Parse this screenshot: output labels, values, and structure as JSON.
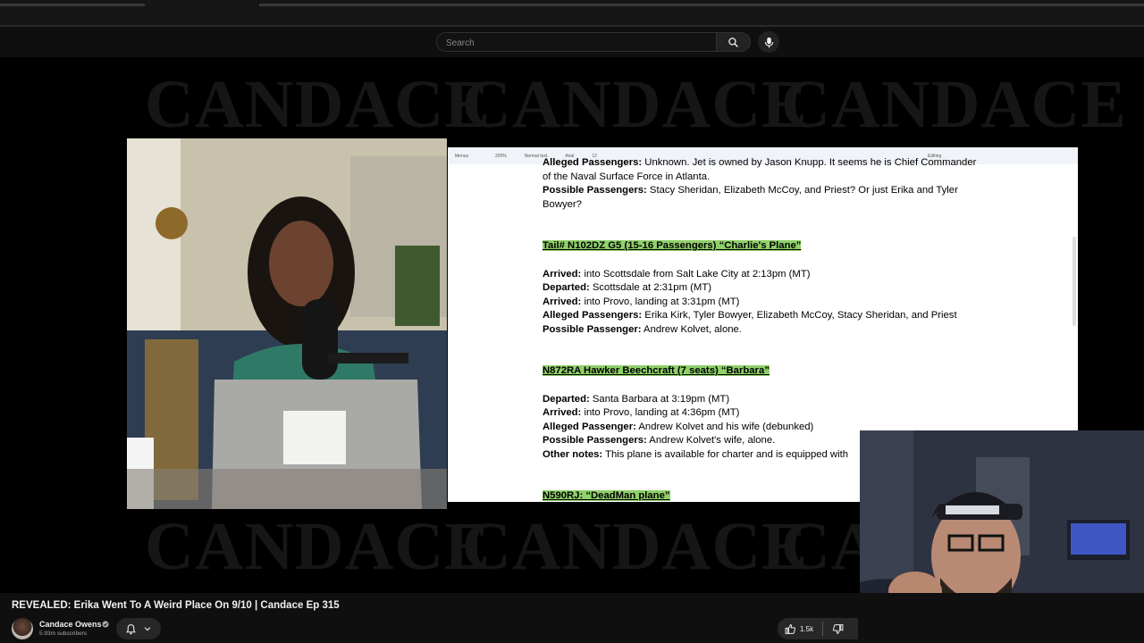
{
  "search": {
    "placeholder": "Search"
  },
  "watermark": {
    "text": "CANDACE"
  },
  "doc": {
    "toolbar": {
      "menus": "Menus",
      "zoom": "200%",
      "style": "Normal text",
      "font": "Arial",
      "size": "12",
      "mode": "Editing"
    },
    "lines": [
      {
        "label": "Alleged Passengers:",
        "text": " Unknown. Jet is owned by Jason Knupp. It seems he is Chief Commander"
      },
      {
        "label": "",
        "text": "of the Naval Surface Force in Atlanta."
      },
      {
        "label": "Possible Passengers:",
        "text": " Stacy Sheridan, Elizabeth McCoy, and Priest? Or just Erika and Tyler"
      },
      {
        "label": "",
        "text": "Bowyer?"
      },
      {
        "heading": "Tail# N102DZ G5 (15-16 Passengers) “Charlie's Plane”"
      },
      {
        "label": "Arrived:",
        "text": " into Scottsdale from Salt Lake City at 2:13pm (MT)"
      },
      {
        "label": "Departed:",
        "text": " Scottsdale at 2:31pm (MT)"
      },
      {
        "label": "Arrived:",
        "text": " into Provo, landing at 3:31pm (MT)"
      },
      {
        "label": "Alleged Passengers:",
        "text": " Erika Kirk, Tyler Bowyer, Elizabeth McCoy, Stacy Sheridan, and Priest"
      },
      {
        "label": "Possible Passenger:",
        "text": " Andrew Kolvet, alone."
      },
      {
        "heading": "N872RA Hawker Beechcraft  (7 seats) “Barbara”"
      },
      {
        "label": "Departed:",
        "text": " Santa Barbara at 3:19pm (MT)"
      },
      {
        "label": "Arrived:",
        "text": " into Provo, landing at 4:36pm (MT)"
      },
      {
        "label": "Alleged Passenger:",
        "text": " Andrew Kolvet and his wife (debunked)"
      },
      {
        "label": "Possible Passengers:",
        "text": " Andrew Kolvet's wife, alone."
      },
      {
        "label": "Other notes:",
        "text": " This plane is available for charter and is equipped with"
      },
      {
        "heading": "N590RJ: “DeadMan plane”"
      }
    ]
  },
  "video": {
    "title": "REVEALED: Erika Went To A Weird Place On 9/10 | Candace Ep 315",
    "channel": "Candace Owens",
    "subscribers": "5.93m subscribers",
    "likes": "1.5k"
  },
  "icons": {
    "search": "search-icon",
    "mic": "microphone-icon",
    "bell": "bell-icon",
    "chevron": "chevron-down-icon",
    "like": "thumbs-up-icon",
    "dislike": "thumbs-down-icon",
    "verified": "verified-check-icon"
  }
}
